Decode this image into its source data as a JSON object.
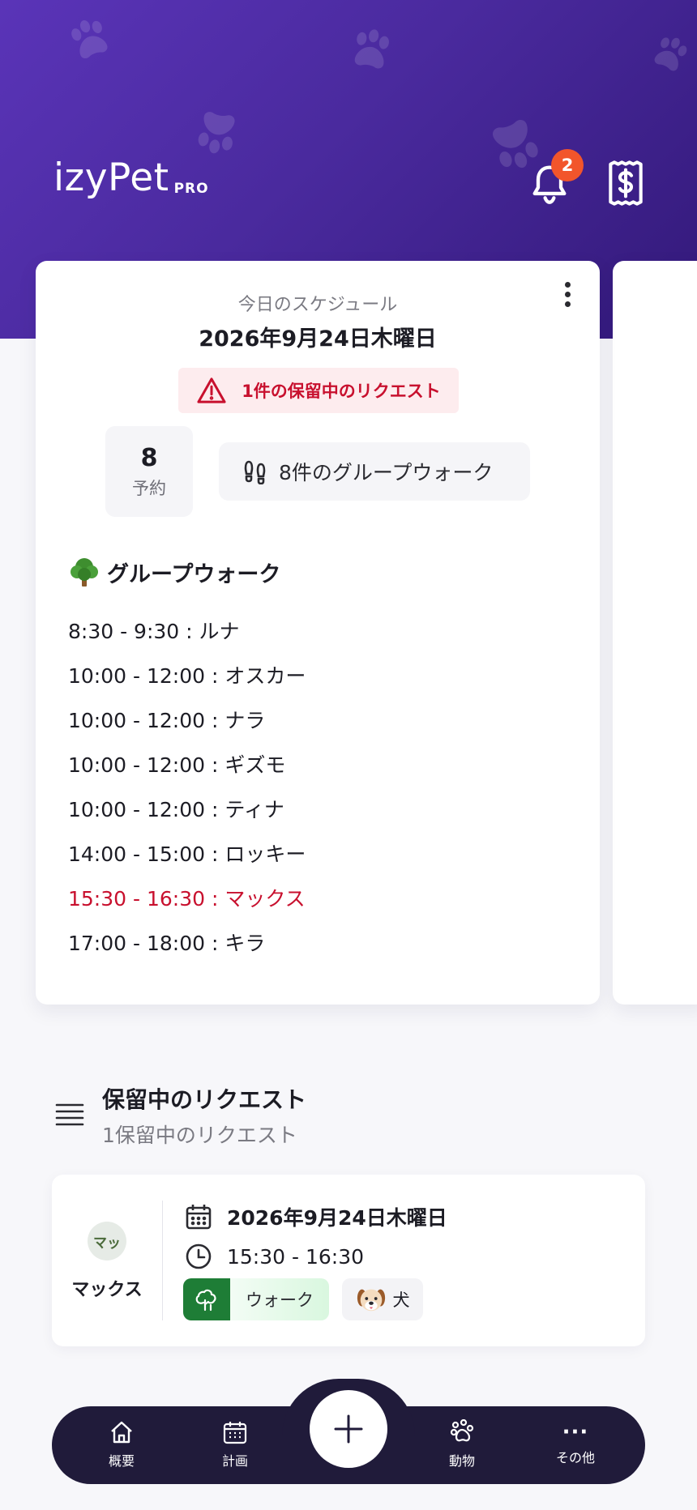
{
  "header": {
    "brand": "izyPet",
    "brand_tag": "PRO",
    "notification_count": "2"
  },
  "schedule": {
    "label": "今日のスケジュール",
    "date": "2026年9月24日木曜日",
    "alert": "1件の保留中のリクエスト",
    "booking_count": "8",
    "booking_label": "予約",
    "group_walk_summary": "8件のグループウォーク",
    "section_title": "グループウォーク",
    "walks": [
      {
        "text": "8:30 - 9:30 : ルナ"
      },
      {
        "text": "10:00 - 12:00 : オスカー"
      },
      {
        "text": "10:00 - 12:00 : ナラ"
      },
      {
        "text": "10:00 - 12:00 : ギズモ"
      },
      {
        "text": "10:00 - 12:00 : ティナ"
      },
      {
        "text": "14:00 - 15:00 : ロッキー"
      },
      {
        "text": "15:30 - 16:30 : マックス"
      },
      {
        "text": "17:00 - 18:00 : キラ"
      }
    ]
  },
  "pending": {
    "title": "保留中のリクエスト",
    "subtitle": "1保留中のリクエスト",
    "request": {
      "avatar_initials": "マッ",
      "pet_name": "マックス",
      "date": "2026年9月24日木曜日",
      "time": "15:30 - 16:30",
      "service": "ウォーク",
      "species": "犬"
    }
  },
  "nav": {
    "overview": "概要",
    "plan": "計画",
    "animals": "動物",
    "more": "その他",
    "more_glyph": "···"
  },
  "colors": {
    "header_top": "#5a34b8",
    "header_bottom": "#33197a",
    "alert_red": "#c8102e",
    "badge_orange": "#f2552b",
    "nav_dark": "#201b3a",
    "walk_green": "#1e7d36"
  }
}
